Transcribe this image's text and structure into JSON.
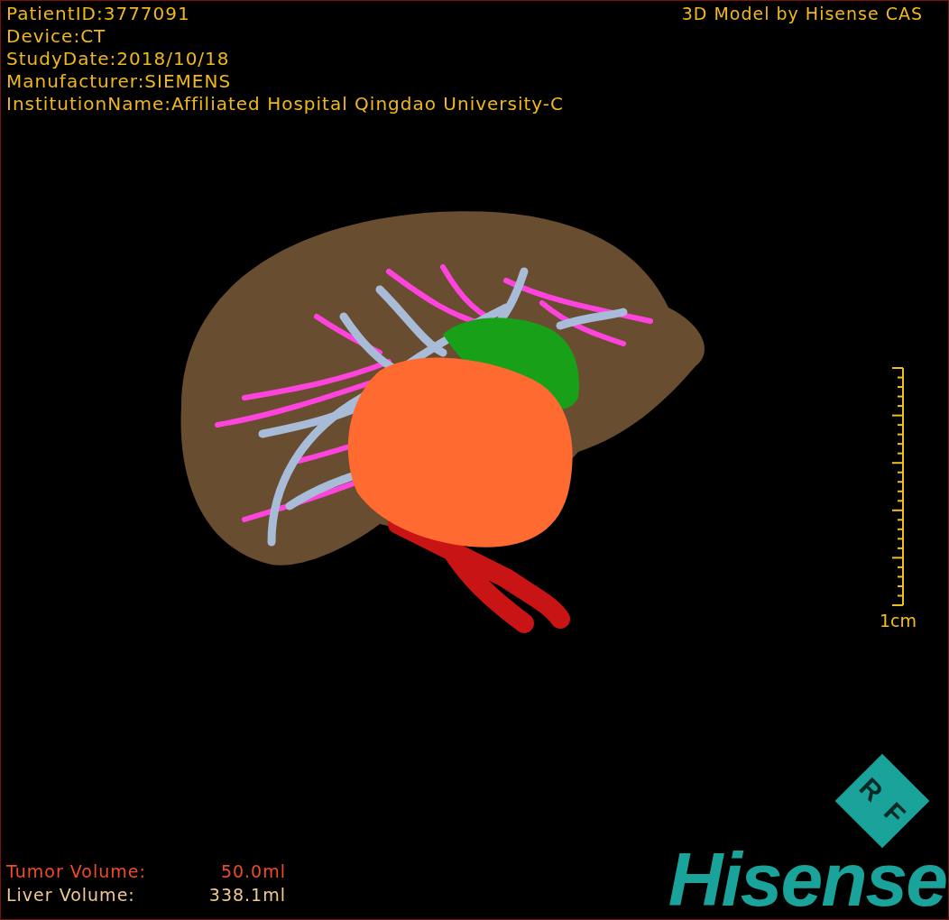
{
  "info_lines": [
    "PatientID:3777091",
    "Device:CT",
    "StudyDate:2018/10/18",
    "Manufacturer:SIEMENS",
    "InstitutionName:Affiliated Hospital Qingdao University-C"
  ],
  "title": "3D Model by Hisense CAS",
  "scale": {
    "label": "1cm"
  },
  "volumes": [
    {
      "kind": "tumor",
      "label": "Tumor Volume:",
      "value": "50.0ml"
    },
    {
      "kind": "liver",
      "label": "Liver Volume:",
      "value": "338.1ml"
    }
  ],
  "logo": {
    "badge": [
      "R",
      "F"
    ],
    "brand": "Hisense"
  }
}
